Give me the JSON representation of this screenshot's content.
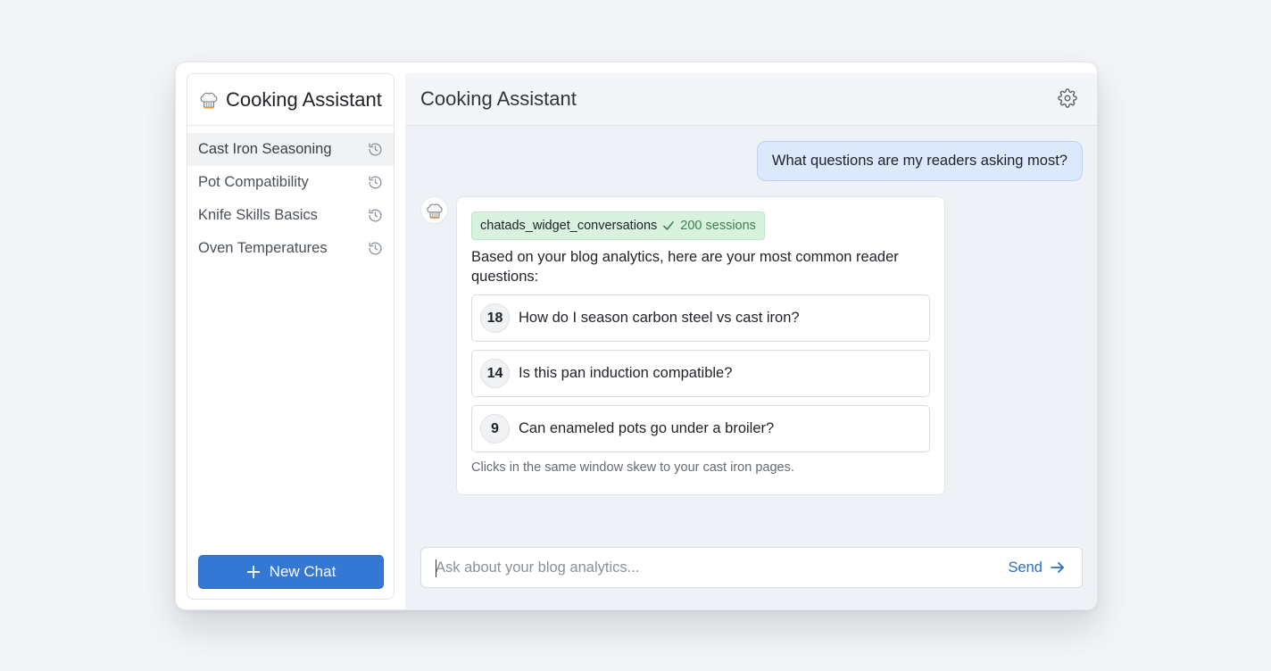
{
  "app": {
    "sidebar_title": "Cooking Assistant",
    "main_title": "Cooking Assistant"
  },
  "sidebar": {
    "items": [
      {
        "label": "Cast Iron Seasoning",
        "active": true
      },
      {
        "label": "Pot Compatibility",
        "active": false
      },
      {
        "label": "Knife Skills Basics",
        "active": false
      },
      {
        "label": "Oven Temperatures",
        "active": false
      }
    ],
    "new_chat_label": "New Chat"
  },
  "conversation": {
    "user_message": "What questions are my readers asking most?",
    "assistant": {
      "tool_name": "chatads_widget_conversations",
      "tool_result": "200 sessions",
      "intro": "Based on your blog analytics, here are your most common reader questions:",
      "questions": [
        {
          "count": "18",
          "text": "How do I season carbon steel vs cast iron?"
        },
        {
          "count": "14",
          "text": "Is this pan induction compatible?"
        },
        {
          "count": "9",
          "text": "Can enameled pots go under a broiler?"
        }
      ],
      "footnote": "Clicks in the same window skew to your cast iron pages."
    }
  },
  "input": {
    "placeholder": "Ask about your blog analytics...",
    "value": "",
    "send_label": "Send"
  },
  "icons": {
    "app": "chef-hat-icon",
    "history": "history-icon",
    "settings": "gear-icon",
    "new_chat": "plus-icon",
    "tool_ok": "check-icon",
    "send": "arrow-right-icon"
  },
  "colors": {
    "accent": "#3578d4",
    "user_bubble": "#dce8fb",
    "tool_badge": "#d9f2df",
    "main_bg": "#eef1f6"
  }
}
